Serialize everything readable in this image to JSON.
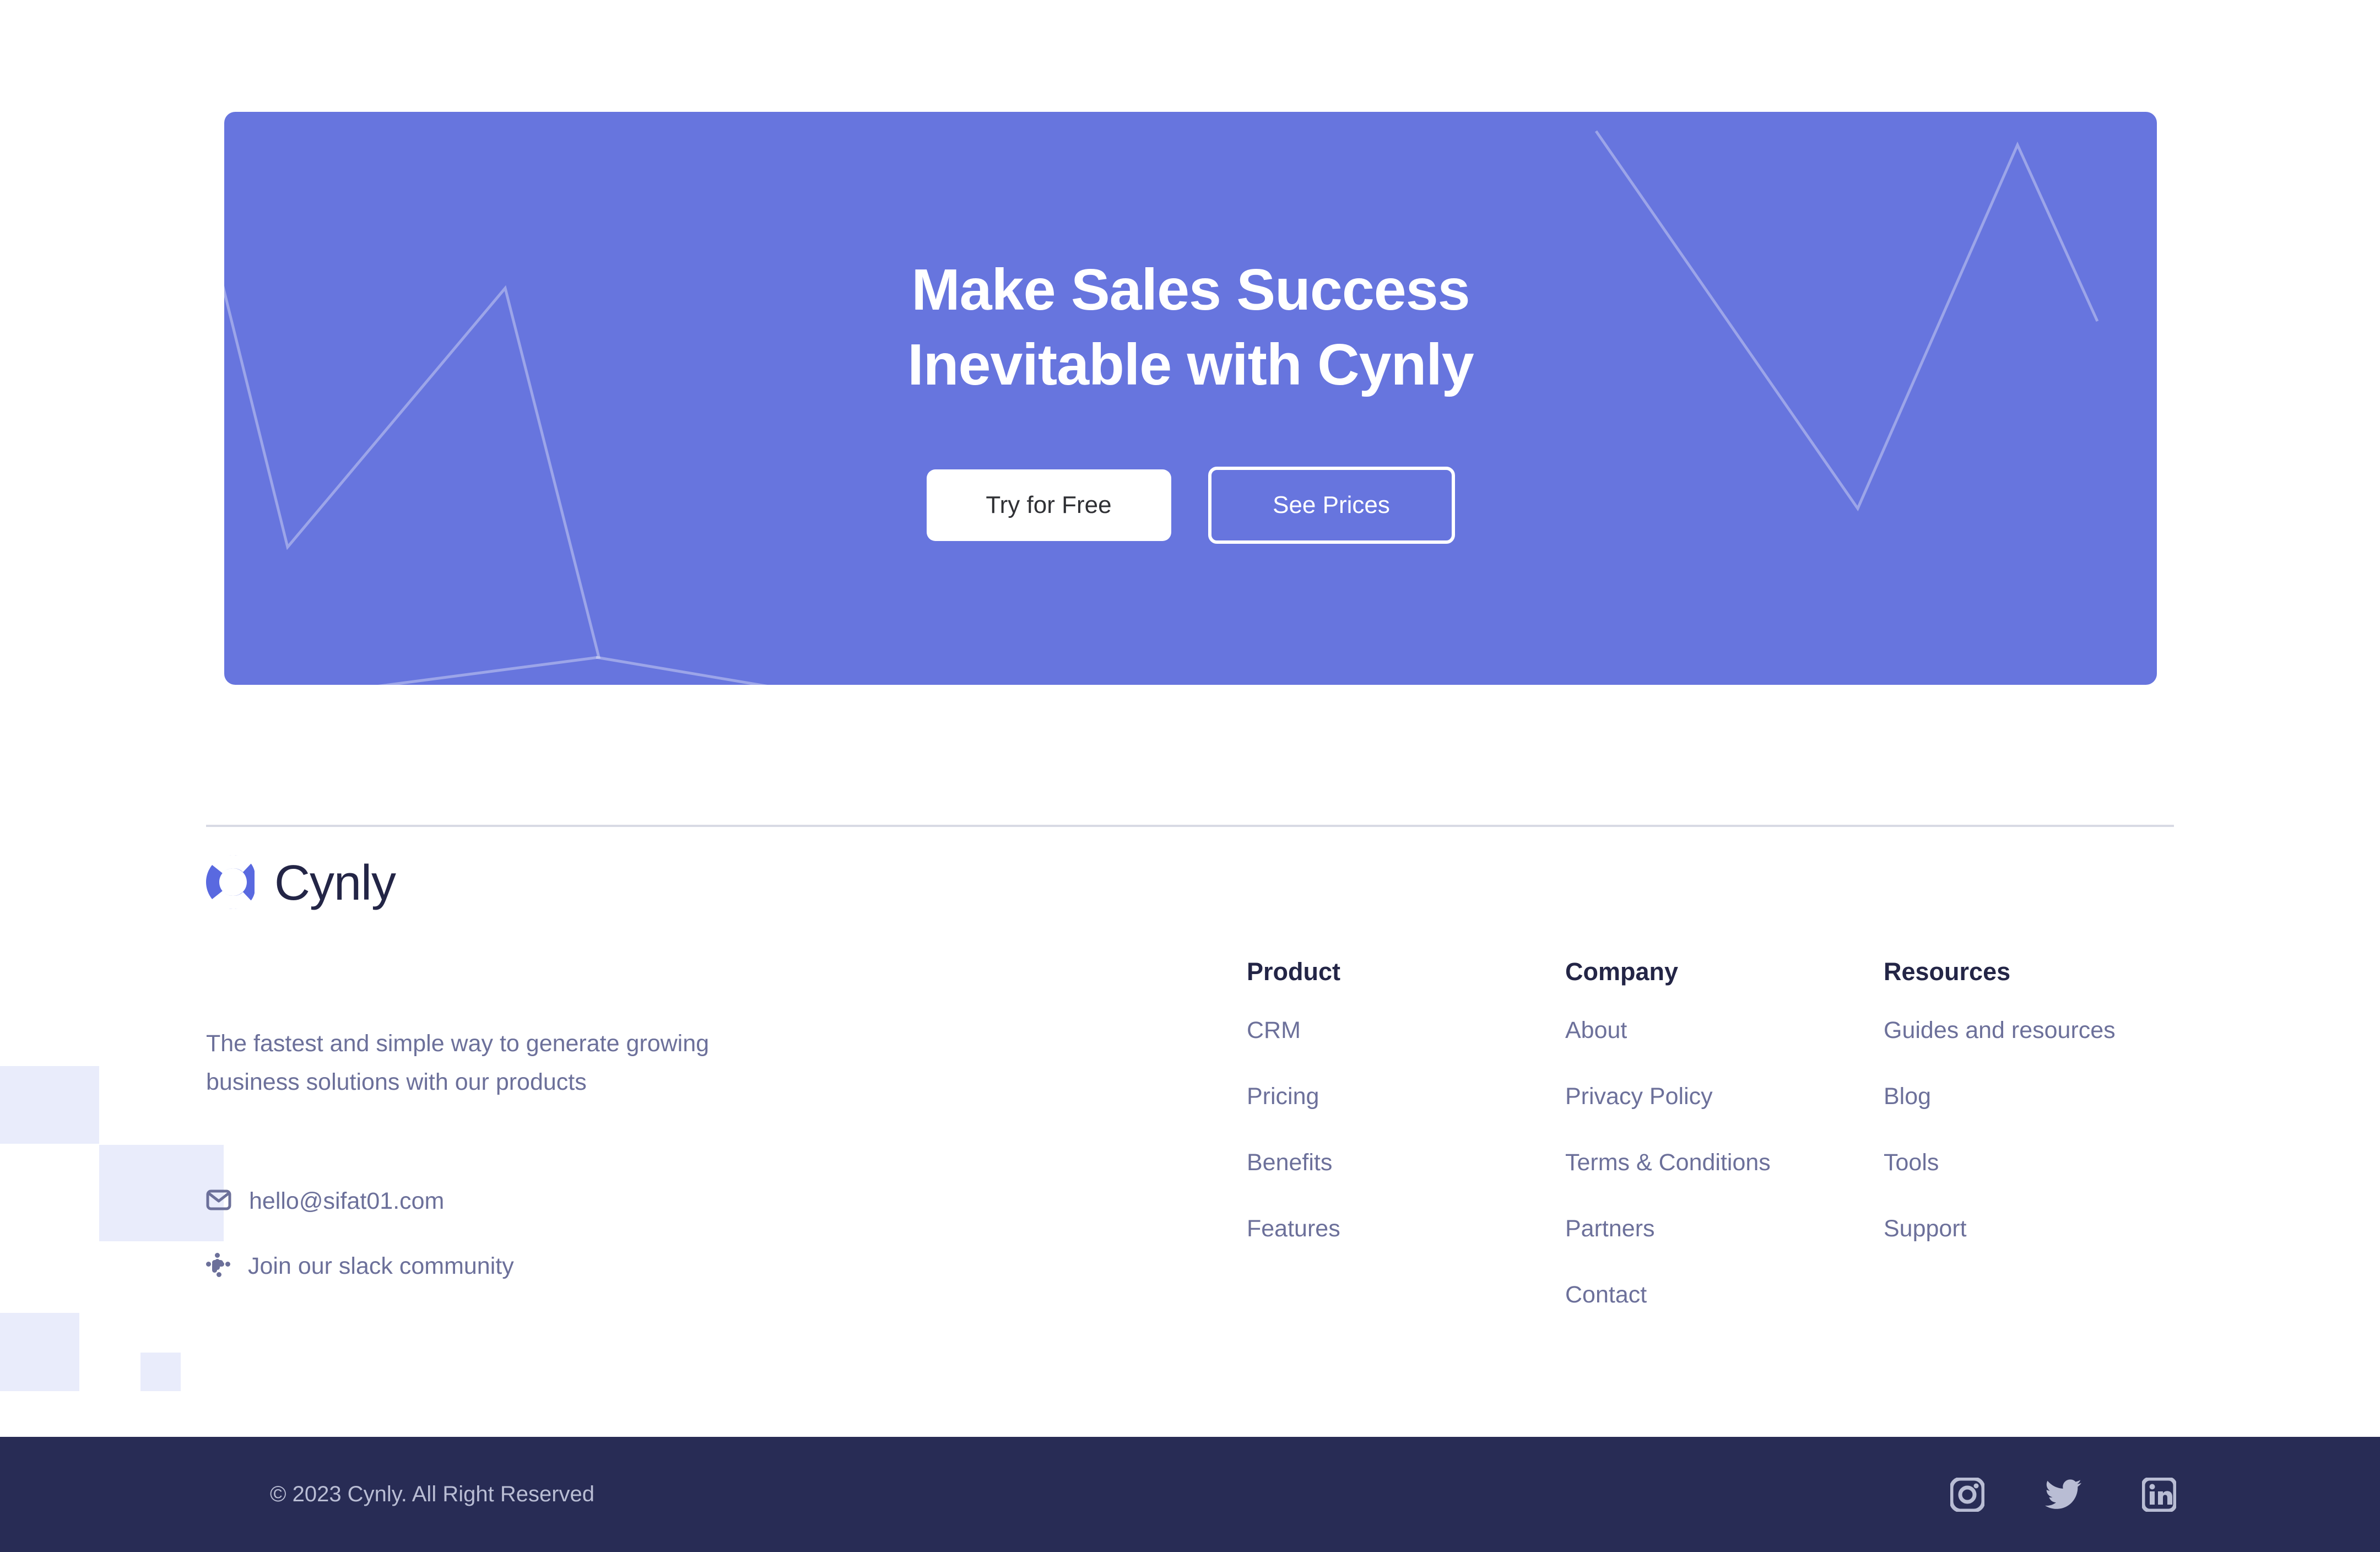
{
  "brand": {
    "name": "Cynly",
    "logo_icon": "cynly-c-logo",
    "accent_color": "#6775DE",
    "dark_color": "#232546",
    "muted_color": "#6C709A",
    "deco_color": "#E9ECFB",
    "bottombar_color": "#282C55"
  },
  "hero": {
    "title_line1": "Make Sales Success",
    "title_line2": "Inevitable with Cynly",
    "primary_cta": "Try for Free",
    "secondary_cta": "See Prices"
  },
  "footer": {
    "description": "The fastest and simple way to generate growing business solutions with our products",
    "contacts": [
      {
        "icon": "envelope-icon",
        "label": "hello@sifat01.com"
      },
      {
        "icon": "slack-icon",
        "label": "Join our slack community"
      }
    ],
    "columns": [
      {
        "title": "Product",
        "links": [
          "CRM",
          "Pricing",
          "Benefits",
          "Features"
        ]
      },
      {
        "title": "Company",
        "links": [
          "About",
          "Privacy Policy",
          "Terms & Conditions",
          "Partners",
          "Contact"
        ]
      },
      {
        "title": "Resources",
        "links": [
          "Guides and resources",
          "Blog",
          "Tools",
          "Support"
        ]
      }
    ]
  },
  "bottombar": {
    "copyright": "© 2023 Cynly. All Right Reserved",
    "socials": [
      {
        "icon": "instagram-icon",
        "name": "Instagram"
      },
      {
        "icon": "twitter-icon",
        "name": "Twitter"
      },
      {
        "icon": "linkedin-icon",
        "name": "LinkedIn"
      }
    ]
  }
}
